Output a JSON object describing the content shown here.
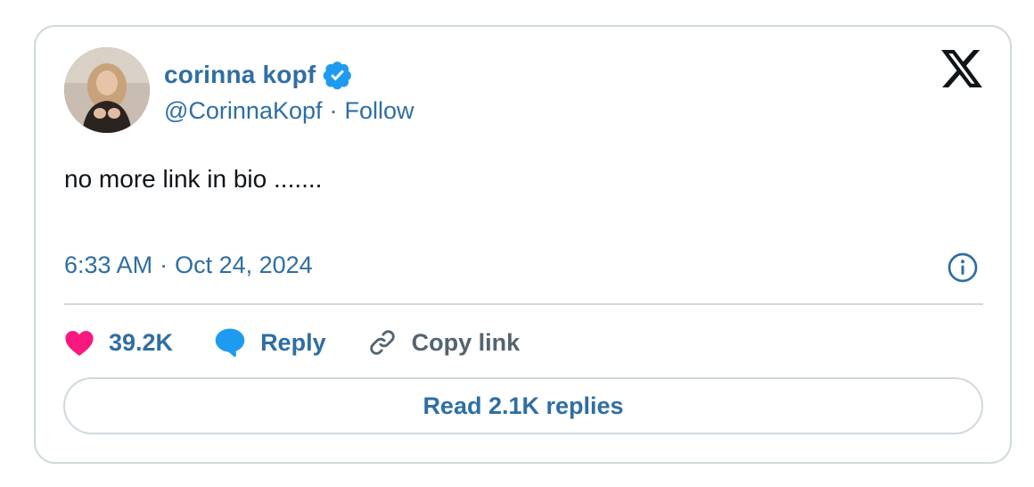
{
  "author": {
    "name": "corinna kopf",
    "handle": "@CorinnaKopf",
    "separator": "·",
    "follow_label": "Follow",
    "verified_icon": "verified-badge-icon"
  },
  "tweet": {
    "text": "no more link in bio .......",
    "time": "6:33 AM",
    "date_separator": "·",
    "date": "Oct 24, 2024"
  },
  "actions": {
    "likes_count": "39.2K",
    "reply_label": "Reply",
    "copy_link_label": "Copy link"
  },
  "footer": {
    "read_replies_label": "Read 2.1K replies"
  },
  "colors": {
    "link_blue": "#2f6ea3",
    "like_pink": "#f91880",
    "reply_blue": "#1d9bf0",
    "verified_blue": "#1d9bf0",
    "border": "#cfd9de",
    "text_dark": "#0f1419",
    "text_gray": "#536471"
  }
}
